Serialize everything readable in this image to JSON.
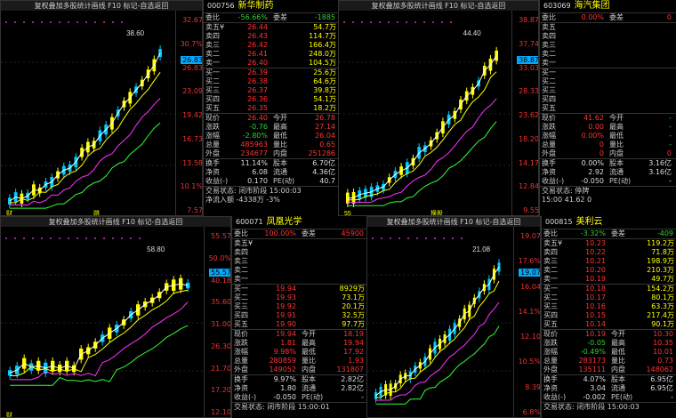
{
  "titlebar": "复权叠加多股统计画线 F10 标记-自选返回",
  "panels": [
    {
      "id": "p1",
      "axis_labels": [
        "32.67",
        "30.7%",
        "26.83",
        "23.09",
        "19.42",
        "16.73",
        "13.58",
        "10.1%",
        "7.57"
      ],
      "highlight": "26.83",
      "peak_label": "38.60",
      "code": "000756",
      "name": "新华制药",
      "weibi": "-56.66%",
      "weicha": "-1885",
      "asks": [
        [
          "卖五¥",
          "26.44",
          "54.7万"
        ],
        [
          "卖四",
          "26.43",
          "114.7万"
        ],
        [
          "卖三",
          "26.42",
          "166.4万"
        ],
        [
          "卖二",
          "26.41",
          "248.0万"
        ],
        [
          "卖一",
          "26.40",
          "104.5万"
        ]
      ],
      "bids": [
        [
          "买一",
          "26.39",
          "25.6万"
        ],
        [
          "买二",
          "26.38",
          "64.6万"
        ],
        [
          "买三",
          "26.37",
          "39.8万"
        ],
        [
          "买四",
          "26.36",
          "54.1万"
        ],
        [
          "买五",
          "26.35",
          "18.2万"
        ]
      ],
      "stats": [
        [
          "现价",
          "26.40",
          "今开",
          "26.78"
        ],
        [
          "涨跌",
          "-0.76",
          "最高",
          "27.14"
        ],
        [
          "涨幅",
          "-2.80%",
          "最低",
          "26.04"
        ],
        [
          "总量",
          "485963",
          "量比",
          "0.65"
        ],
        [
          "外盘",
          "234677",
          "内盘",
          "251286"
        ]
      ],
      "stats2": [
        [
          "换手",
          "11.14%",
          "股本",
          "6.70亿"
        ],
        [
          "净资",
          "6.08",
          "流通",
          "4.36亿"
        ],
        [
          "收益(-)",
          "0.170",
          "PE(动)",
          "40.7"
        ]
      ],
      "status1": "交易状态: 闭市阶段 15:00:03",
      "status2": "净流入额  -4338万 -3%",
      "bottom_marks": [
        "财",
        "跳"
      ]
    },
    {
      "id": "p2",
      "axis_labels": [
        "38.87",
        "37.74",
        "33.03",
        "28.33",
        "23.62",
        "18.20",
        "14.17",
        "12.84",
        "9.55"
      ],
      "highlight": "38.87",
      "peak_label": "44.40",
      "code": "603069",
      "name": "海汽集团",
      "weibi": "0.00%",
      "weicha": "0",
      "asks": [
        [
          "卖五",
          "",
          ""
        ],
        [
          "卖四",
          "",
          ""
        ],
        [
          "卖三",
          "",
          ""
        ],
        [
          "卖二",
          "",
          ""
        ],
        [
          "卖一",
          "",
          ""
        ]
      ],
      "bids": [
        [
          "买一",
          "",
          ""
        ],
        [
          "买二",
          "",
          ""
        ],
        [
          "买三",
          "",
          ""
        ],
        [
          "买四",
          "",
          ""
        ],
        [
          "买五",
          "",
          ""
        ]
      ],
      "stats": [
        [
          "现价",
          "41.62",
          "今开",
          "-"
        ],
        [
          "涨跌",
          "0.00",
          "最高",
          "-"
        ],
        [
          "涨幅",
          "0.00%",
          "最低",
          "-"
        ],
        [
          "总量",
          "0",
          "量比",
          "-"
        ],
        [
          "外盘",
          "0",
          "内盘",
          "0"
        ]
      ],
      "stats2": [
        [
          "换手",
          "0.00%",
          "股本",
          "3.16亿"
        ],
        [
          "净资",
          "2.92",
          "流通",
          "3.16亿"
        ],
        [
          "收益(-)",
          "-0.050",
          "PE(动)",
          "-"
        ]
      ],
      "status1": "交易状态: 停牌",
      "status2": "15:00    41.62    0",
      "bottom_marks": [
        "55",
        "换股"
      ]
    },
    {
      "id": "p3",
      "axis_labels": [
        "55.57",
        "50.0%",
        "40.18",
        "35.60",
        "31.00",
        "26.30",
        "21.70",
        "17.20",
        "12.10"
      ],
      "highlight": "55.57",
      "peak_label": "58.80",
      "code": "600071",
      "name": "凤凰光学",
      "weibi": "100.00%",
      "weicha": "45900",
      "asks": [
        [
          "卖五¥",
          "",
          ""
        ],
        [
          "卖四",
          "",
          ""
        ],
        [
          "卖三",
          "",
          ""
        ],
        [
          "卖二",
          "",
          ""
        ],
        [
          "卖一",
          "",
          ""
        ]
      ],
      "bids": [
        [
          "买一",
          "19.94",
          "8929万"
        ],
        [
          "买二",
          "19.93",
          "73.1万"
        ],
        [
          "买三",
          "19.92",
          "20.1万"
        ],
        [
          "买四",
          "19.91",
          "32.5万"
        ],
        [
          "买五",
          "19.90",
          "97.7万"
        ]
      ],
      "stats": [
        [
          "现价",
          "19.94",
          "今开",
          "18.19"
        ],
        [
          "涨跌",
          "1.81",
          "最高",
          "19.94"
        ],
        [
          "涨幅",
          "9.98%",
          "最低",
          "17.92"
        ],
        [
          "总量",
          "280859",
          "量比",
          "1.93"
        ],
        [
          "外盘",
          "149052",
          "内盘",
          "131807"
        ]
      ],
      "stats2": [
        [
          "换手",
          "9.97%",
          "股本",
          "2.82亿"
        ],
        [
          "净资",
          "1.80",
          "流通",
          "2.82亿"
        ],
        [
          "收益(-)",
          "-0.050",
          "PE(动)",
          "-"
        ]
      ],
      "status1": "交易状态: 闭市阶段 15:00:01",
      "status2": "",
      "bottom_marks": [
        "财"
      ]
    },
    {
      "id": "p4",
      "axis_labels": [
        "19.07",
        "17.6%",
        "16.04",
        "14.1%",
        "12.10",
        "10.5%",
        "8.39",
        "6.8%"
      ],
      "highlight": "19.07",
      "peak_label": "21.08",
      "code": "000815",
      "name": "美利云",
      "weibi": "-3.32%",
      "weicha": "-409",
      "asks": [
        [
          "卖五¥",
          "10.23",
          "119.2万"
        ],
        [
          "卖四",
          "10.22",
          "71.8万"
        ],
        [
          "卖三",
          "10.21",
          "198.9万"
        ],
        [
          "卖二",
          "10.20",
          "210.3万"
        ],
        [
          "卖一",
          "10.19",
          "49.7万"
        ]
      ],
      "bids": [
        [
          "买一",
          "10.18",
          "154.2万"
        ],
        [
          "买二",
          "10.17",
          "80.1万"
        ],
        [
          "买三",
          "10.16",
          "63.3万"
        ],
        [
          "买四",
          "10.15",
          "217.4万"
        ],
        [
          "买五",
          "10.14",
          "90.1万"
        ]
      ],
      "stats": [
        [
          "现价",
          "10.19",
          "今开",
          "10.30"
        ],
        [
          "涨跌",
          "-0.05",
          "最高",
          "10.35"
        ],
        [
          "涨幅",
          "-0.49%",
          "最低",
          "10.01"
        ],
        [
          "总量",
          "283173",
          "量比",
          "0.73"
        ],
        [
          "外盘",
          "135111",
          "内盘",
          "148062"
        ]
      ],
      "stats2": [
        [
          "换手",
          "4.07%",
          "股本",
          "6.95亿"
        ],
        [
          "净资",
          "3.04",
          "流通",
          "6.95亿"
        ],
        [
          "收益(-)",
          "-0.002",
          "PE(动)",
          "-"
        ]
      ],
      "status1": "交易状态: 闭市阶段 15:00:03",
      "status2": "",
      "bottom_marks": []
    }
  ],
  "labels": {
    "weibi": "委比",
    "weicha": "委差"
  },
  "colors": {
    "up": "#ff3333",
    "down": "#33cc33",
    "ma1": "#ffffff",
    "ma2": "#ffff00",
    "ma3": "#ff33ff",
    "ma4": "#33ff33",
    "bg": "#000000",
    "accent": "#00aaff"
  }
}
